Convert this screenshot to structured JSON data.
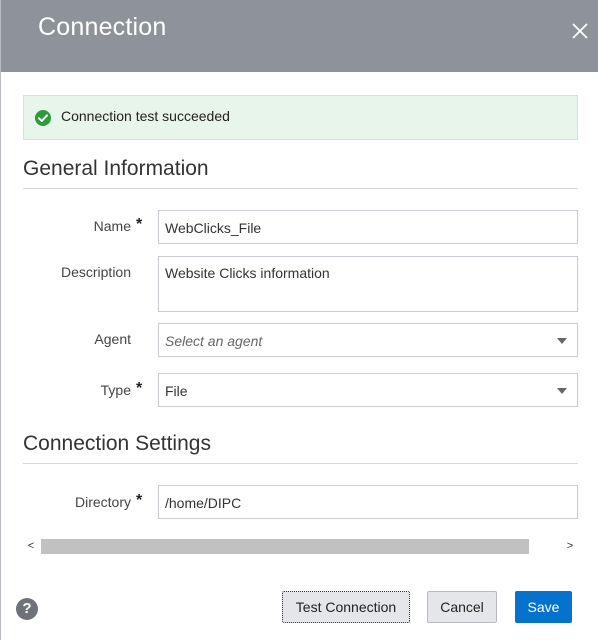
{
  "dialog": {
    "title": "Connection",
    "close_label": "×"
  },
  "banner": {
    "text": "Connection test succeeded",
    "status": "success",
    "color": "#2e9a3e"
  },
  "general": {
    "title": "General Information",
    "name": {
      "label": "Name",
      "required": "*",
      "value": "WebClicks_File"
    },
    "description": {
      "label": "Description",
      "value": "Website Clicks information"
    },
    "agent": {
      "label": "Agent",
      "placeholder": "Select an agent"
    },
    "type": {
      "label": "Type",
      "required": "*",
      "value": "File"
    }
  },
  "connection": {
    "title": "Connection Settings",
    "directory": {
      "label": "Directory",
      "required": "*",
      "value": "/home/DIPC"
    }
  },
  "scrollbar": {
    "left_arrow": "<",
    "right_arrow": ">"
  },
  "footer": {
    "help_label": "?",
    "test_label": "Test Connection",
    "cancel_label": "Cancel",
    "save_label": "Save",
    "primary_color": "#0572ce"
  }
}
